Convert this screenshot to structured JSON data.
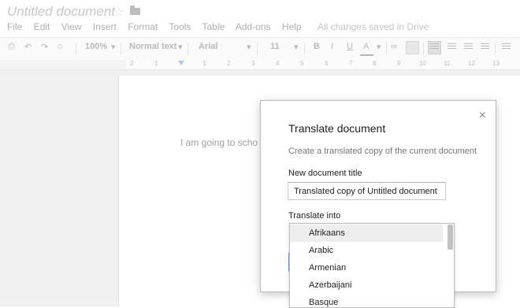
{
  "header": {
    "doc_title": "Untitled document",
    "menu": [
      "File",
      "Edit",
      "View",
      "Insert",
      "Format",
      "Tools",
      "Table",
      "Add-ons",
      "Help"
    ],
    "save_status": "All changes saved in Drive"
  },
  "toolbar": {
    "zoom": "100%",
    "style": "Normal text",
    "font": "Arial",
    "size": "11",
    "bold": "B",
    "italic": "I",
    "underline": "U",
    "text_color": "A"
  },
  "ruler": {
    "numbers": [
      "2",
      "1",
      "1",
      "2",
      "3",
      "4",
      "5",
      "6",
      "7",
      "8",
      "9",
      "10",
      "11",
      "12",
      "13"
    ]
  },
  "document": {
    "body_text": "I am going to scho"
  },
  "dialog": {
    "title": "Translate document",
    "description": "Create a translated copy of the current document",
    "title_field_label": "New document title",
    "title_field_value": "Translated copy of Untitled document",
    "translate_label": "Translate into",
    "close_icon": "×",
    "languages": [
      "Afrikaans",
      "Arabic",
      "Armenian",
      "Azerbaijani",
      "Basque"
    ],
    "selected_language": "Afrikaans"
  },
  "colors": {
    "accent_blue": "#6a9ee0",
    "selected_bg": "#eeeeee"
  }
}
